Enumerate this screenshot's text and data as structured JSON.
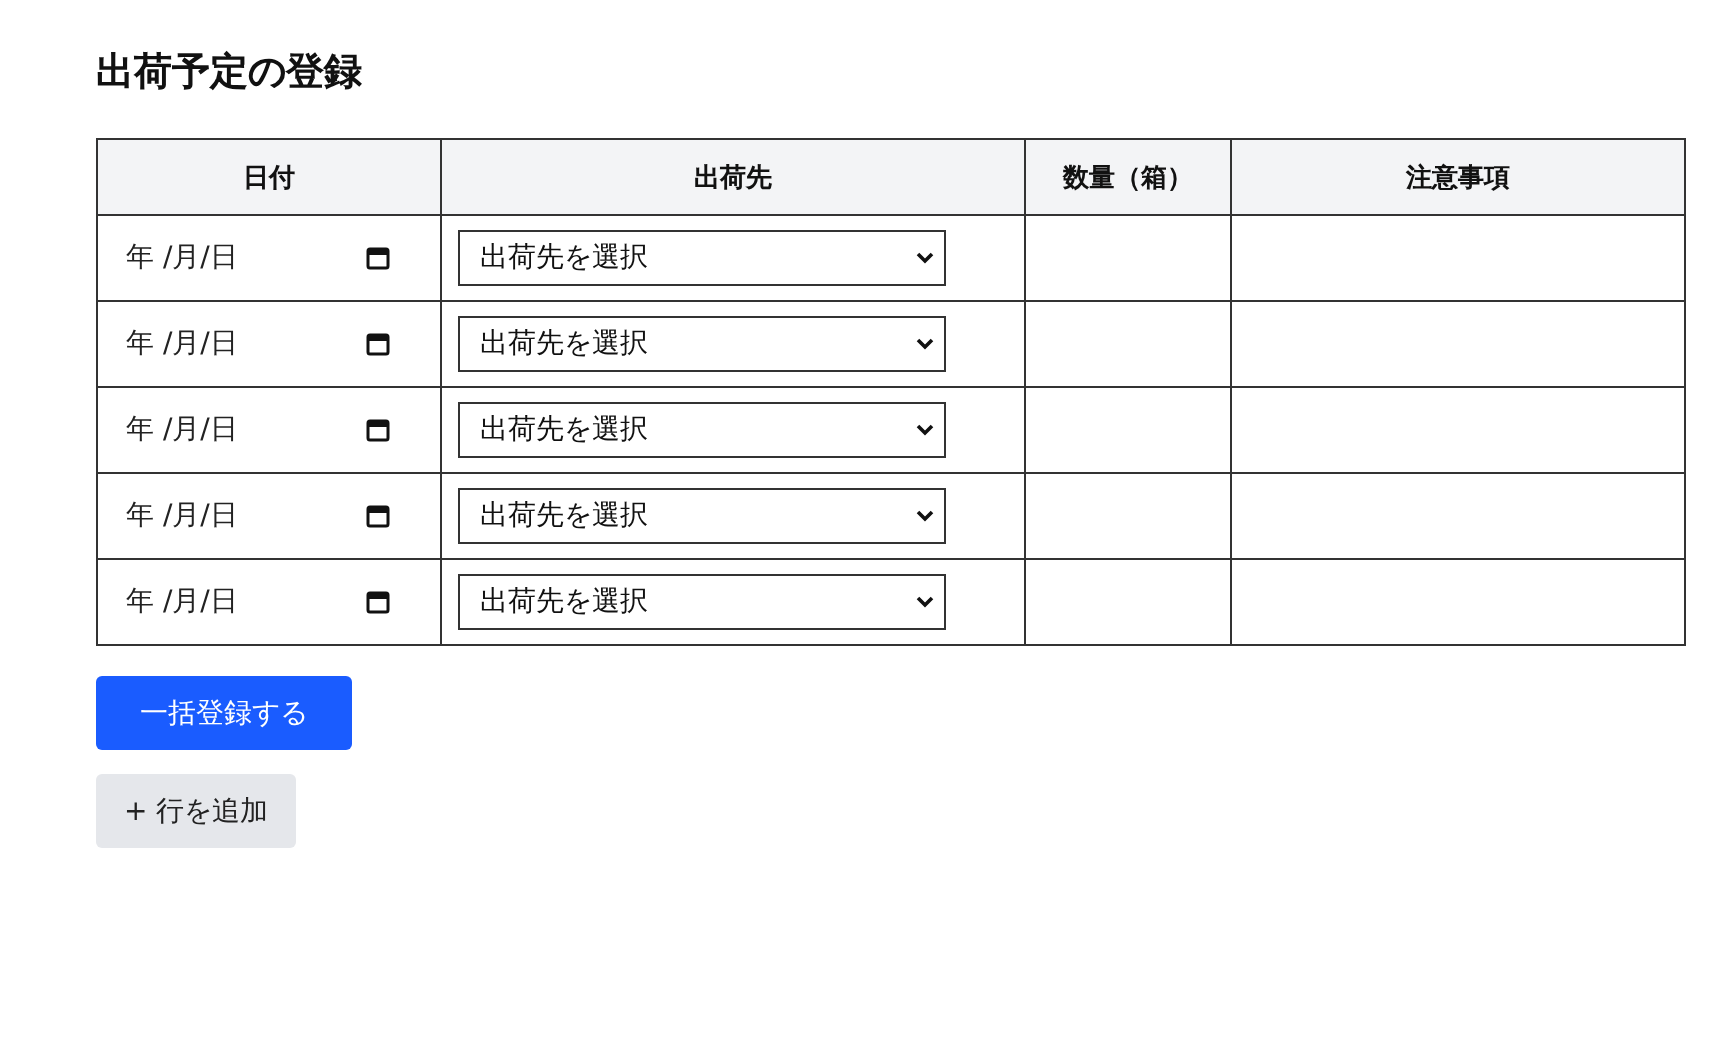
{
  "title": "出荷予定の登録",
  "table": {
    "columns": [
      "日付",
      "出荷先",
      "数量（箱）",
      "注意事項"
    ],
    "rows": [
      {
        "date": {
          "placeholder": "年 /月/日"
        },
        "destination": {
          "placeholder": "出荷先を選択"
        }
      },
      {
        "date": {
          "placeholder": "年 /月/日"
        },
        "destination": {
          "placeholder": "出荷先を選択"
        }
      },
      {
        "date": {
          "placeholder": "年 /月/日"
        },
        "destination": {
          "placeholder": "出荷先を選択"
        }
      },
      {
        "date": {
          "placeholder": "年 /月/日"
        },
        "destination": {
          "placeholder": "出荷先を選択"
        }
      },
      {
        "date": {
          "placeholder": "年 /月/日"
        },
        "destination": {
          "placeholder": "出荷先を選択"
        }
      }
    ]
  },
  "buttons": [
    {
      "kind": "primary",
      "label": "一括登録する"
    },
    {
      "kind": "secondary",
      "label": "+ 行を追加"
    }
  ]
}
